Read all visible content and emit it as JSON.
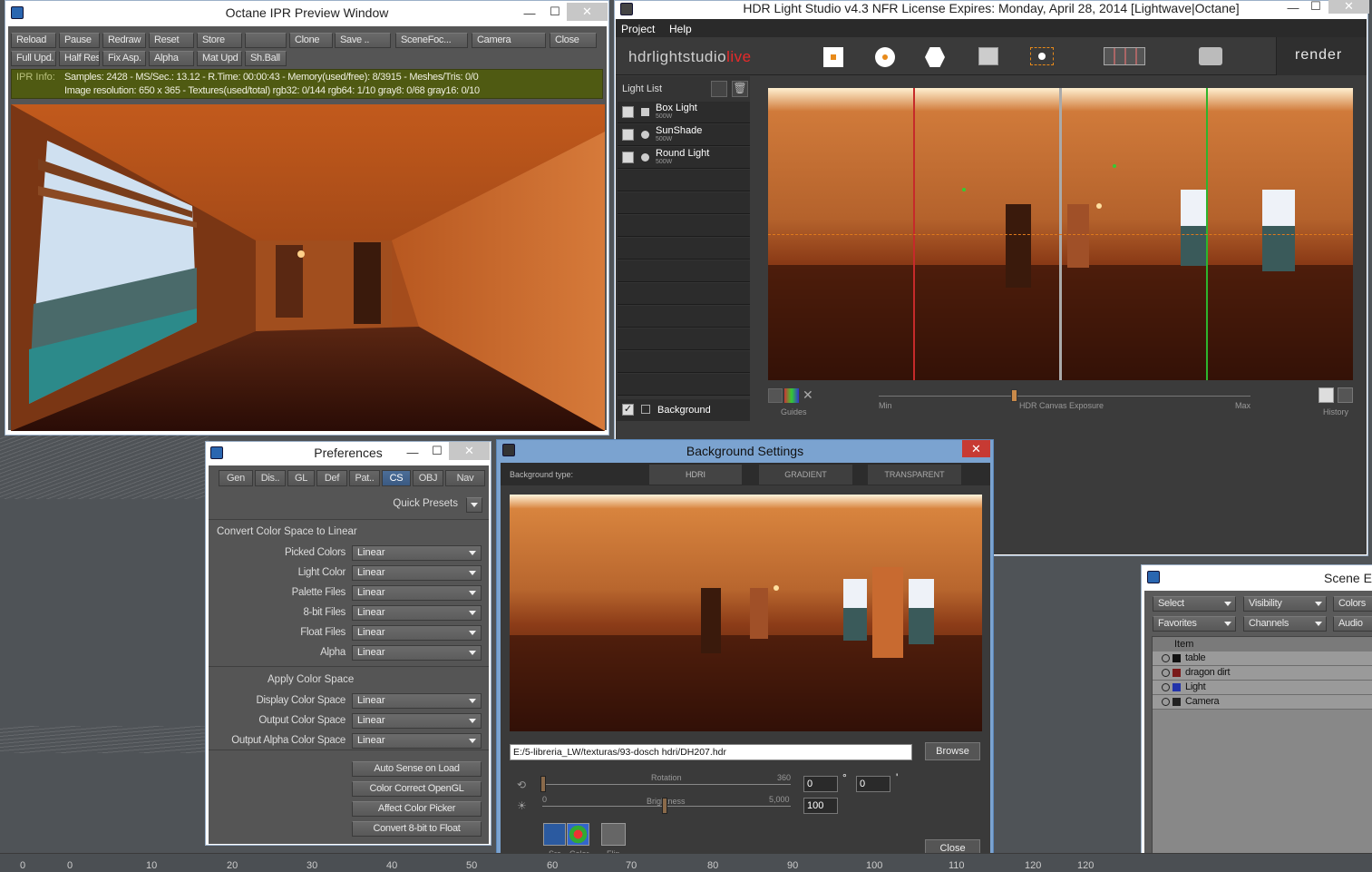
{
  "octane": {
    "title": "Octane IPR Preview Window",
    "toolbar_row1": [
      "Reload",
      "Pause",
      "Redraw",
      "Reset",
      "Store",
      "",
      "Clone",
      "Save ..",
      "SceneFoc...",
      "Camera",
      "Close"
    ],
    "toolbar_row2": [
      "Full Upd.",
      "Half Res",
      "Fix Asp.",
      "Alpha",
      "Mat Upd",
      "Sh.Ball"
    ],
    "info_label": "IPR Info:",
    "info_line1": "Samples: 2428  -  MS/Sec.: 13.12  -  R.Time: 00:00:43 - Memory(used/free): 8/3915  -  Meshes/Tris: 0/0",
    "info_line2": "Image resolution: 650 x 365 - Textures(used/total) rgb32: 0/144   rgb64: 1/10   gray8: 0/68   gray16: 0/10"
  },
  "hdr": {
    "title": "HDR Light Studio v4.3 NFR License Expires: Monday, April 28, 2014  [Lightwave|Octane]",
    "menu": [
      "Project",
      "Help"
    ],
    "logo_main": "hdrlightstudio",
    "logo_accent": "live",
    "render_label": "render",
    "light_list_label": "Light List",
    "lights": [
      {
        "name": "Box Light",
        "power": "500W"
      },
      {
        "name": "SunShade",
        "power": "500W"
      },
      {
        "name": "Round Light",
        "power": "500W"
      }
    ],
    "background_label": "Background",
    "guides_label": "Guides",
    "exposure_min": "Min",
    "exposure_label": "HDR Canvas Exposure",
    "exposure_max": "Max",
    "history_label": "History"
  },
  "prefs": {
    "title": "Preferences",
    "tabs": [
      "Gen",
      "Dis..",
      "GL",
      "Def",
      "Pat..",
      "CS",
      "OBJ",
      "Nav"
    ],
    "active_tab": "CS",
    "quick_presets": "Quick Presets",
    "section1": "Convert Color Space to Linear",
    "rows1": [
      {
        "label": "Picked Colors",
        "value": "Linear"
      },
      {
        "label": "Light Color",
        "value": "Linear"
      },
      {
        "label": "Palette Files",
        "value": "Linear"
      },
      {
        "label": "8-bit Files",
        "value": "Linear"
      },
      {
        "label": "Float Files",
        "value": "Linear"
      },
      {
        "label": "Alpha",
        "value": "Linear"
      }
    ],
    "section2": "Apply Color Space",
    "rows2": [
      {
        "label": "Display Color Space",
        "value": "Linear"
      },
      {
        "label": "Output Color Space",
        "value": "Linear"
      },
      {
        "label": "Output Alpha Color Space",
        "value": "Linear"
      }
    ],
    "buttons": [
      "Auto Sense on Load",
      "Color Correct OpenGL",
      "Affect Color Picker",
      "Convert 8-bit to Float"
    ]
  },
  "bg": {
    "title": "Background Settings",
    "type_label": "Background type:",
    "types": [
      "HDRI",
      "GRADIENT",
      "TRANSPARENT"
    ],
    "path": "E:/5-libreria_LW/texturas/93-dosch hdri/DH207.hdr",
    "browse": "Browse",
    "rotation_label": "Rotation",
    "rotation_max": "360",
    "rotation_value": "0",
    "rotation_unit": "°",
    "rotation2_value": "0",
    "rotation2_unit": "'",
    "brightness_label": "Brightness",
    "brightness_min": "0",
    "brightness_max": "5,000",
    "brightness_value": "100",
    "icons": [
      "Src",
      "Color",
      "Flip"
    ],
    "close": "Close"
  },
  "scene": {
    "title": "Scene Ed",
    "row1": [
      "Select",
      "Visibility",
      "Colors"
    ],
    "row2": [
      "Favorites",
      "Channels",
      "Audio"
    ],
    "header": "Item",
    "items": [
      "table",
      "dragon dirt",
      "Light",
      "Camera"
    ]
  },
  "ruler": [
    "0",
    "0",
    "10",
    "20",
    "30",
    "40",
    "50",
    "60",
    "70",
    "80",
    "90",
    "100",
    "110",
    "120",
    "120"
  ],
  "colors": {
    "accent_red": "#c62a2a",
    "accent_green": "#2db52d",
    "orange_dashed": "#e07a1c",
    "ipr_info_bg": "#4f5a12"
  }
}
